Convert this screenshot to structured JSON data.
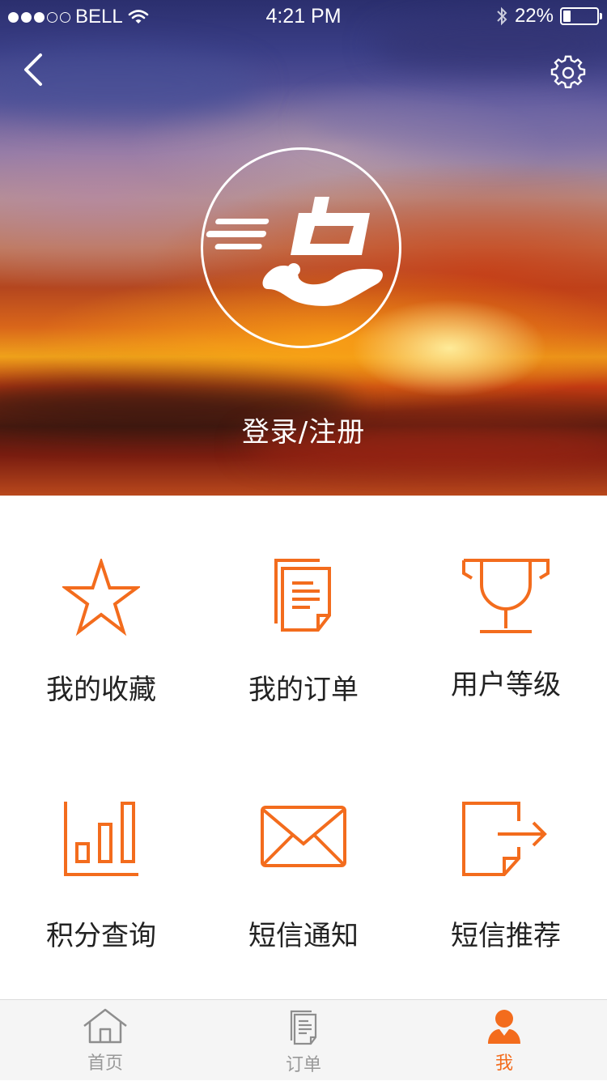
{
  "status_bar": {
    "carrier": "BELL",
    "time": "4:21 PM",
    "battery": "22%",
    "battery_level": 0.22,
    "signal_bars_filled": 3,
    "signal_bars_total": 5
  },
  "header": {
    "back_icon": "chevron-left-icon",
    "settings_icon": "gear-icon",
    "avatar_logo": "dian-logo",
    "login_label": "登录/注册"
  },
  "menu": {
    "items": [
      {
        "label": "我的收藏",
        "icon": "star-icon"
      },
      {
        "label": "我的订单",
        "icon": "document-icon"
      },
      {
        "label": "用户等级",
        "icon": "trophy-icon"
      },
      {
        "label": "积分查询",
        "icon": "bar-chart-icon"
      },
      {
        "label": "短信通知",
        "icon": "envelope-icon"
      },
      {
        "label": "短信推荐",
        "icon": "share-export-icon"
      }
    ]
  },
  "tabbar": {
    "tabs": [
      {
        "label": "首页",
        "icon": "home-icon",
        "active": false
      },
      {
        "label": "订单",
        "icon": "order-icon",
        "active": false
      },
      {
        "label": "我",
        "icon": "user-icon",
        "active": true
      }
    ]
  },
  "colors": {
    "accent": "#f36c1d",
    "text_dark": "#222222",
    "tab_inactive": "#999999",
    "tabbar_bg": "#f5f5f5"
  }
}
